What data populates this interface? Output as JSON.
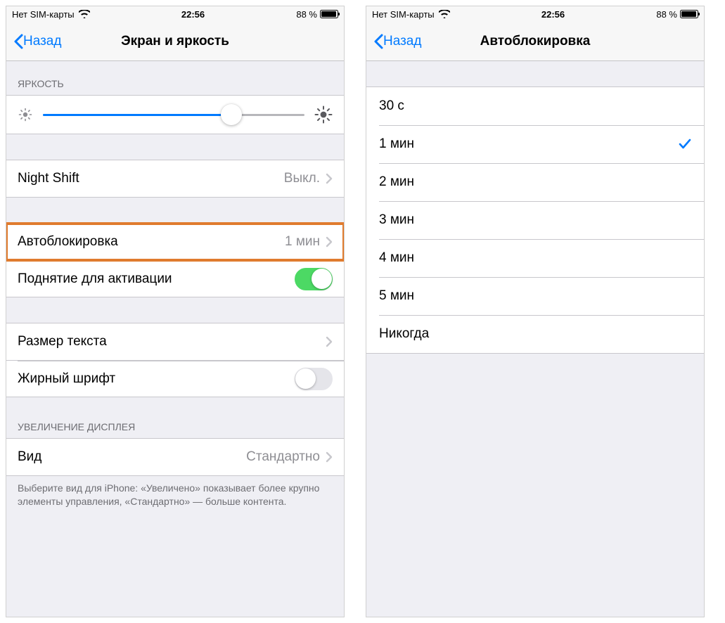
{
  "statusbar": {
    "carrier": "Нет SIM-карты",
    "time": "22:56",
    "battery_pct": "88 %",
    "battery_fill_pct": 88
  },
  "screen1": {
    "nav": {
      "back": "Назад",
      "title": "Экран и яркость"
    },
    "sections": {
      "brightness_header": "ЯРКОСТЬ",
      "slider_pct": 72,
      "night_shift": {
        "label": "Night Shift",
        "value": "Выкл."
      },
      "autolock": {
        "label": "Автоблокировка",
        "value": "1 мин"
      },
      "raise_to_wake": {
        "label": "Поднятие для активации",
        "on": true
      },
      "text_size": {
        "label": "Размер текста"
      },
      "bold_text": {
        "label": "Жирный шрифт",
        "on": false
      },
      "display_zoom_header": "УВЕЛИЧЕНИЕ ДИСПЛЕЯ",
      "view": {
        "label": "Вид",
        "value": "Стандартно"
      },
      "footer": "Выберите вид для iPhone: «Увеличено» показывает более крупно элементы управления, «Стандартно» — больше контента."
    }
  },
  "screen2": {
    "nav": {
      "back": "Назад",
      "title": "Автоблокировка"
    },
    "options": [
      {
        "label": "30 с",
        "selected": false
      },
      {
        "label": "1 мин",
        "selected": true
      },
      {
        "label": "2 мин",
        "selected": false
      },
      {
        "label": "3 мин",
        "selected": false
      },
      {
        "label": "4 мин",
        "selected": false
      },
      {
        "label": "5 мин",
        "selected": false
      },
      {
        "label": "Никогда",
        "selected": false
      }
    ]
  }
}
